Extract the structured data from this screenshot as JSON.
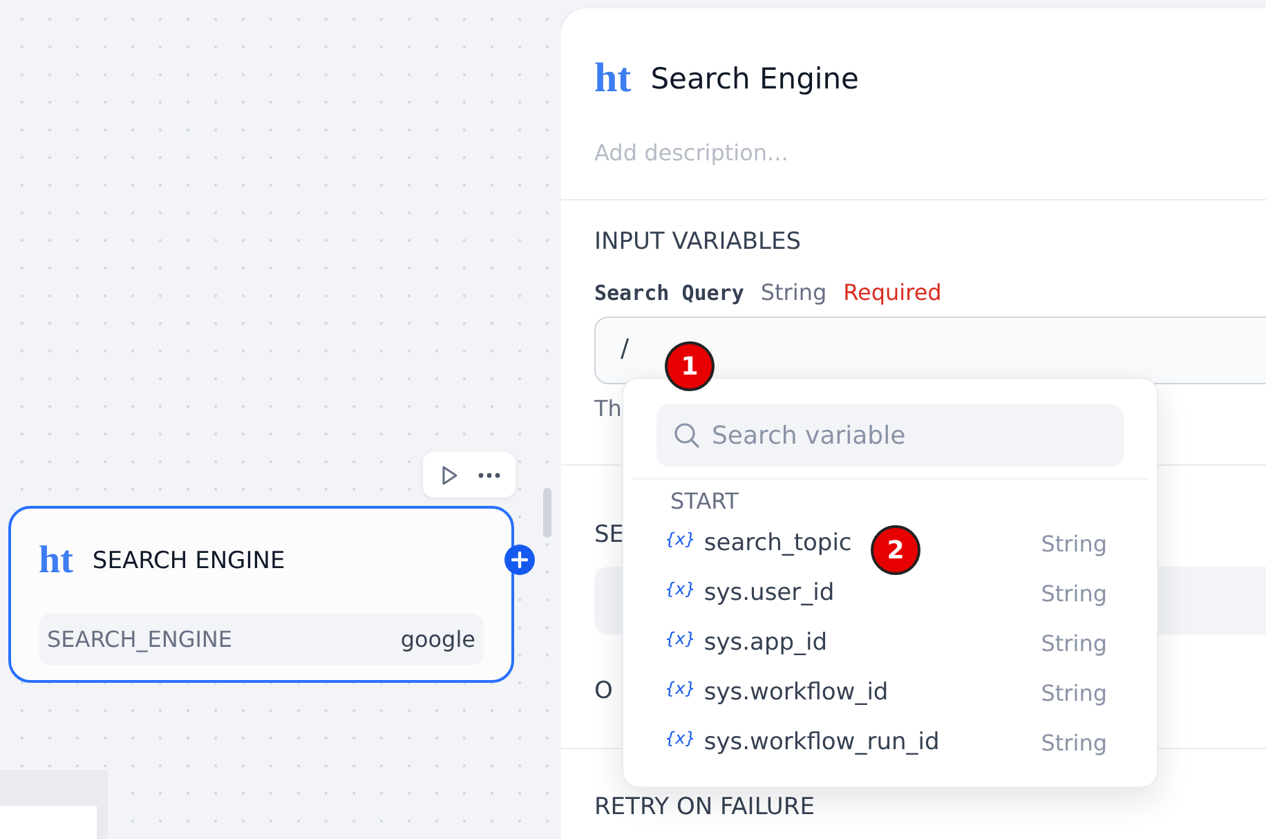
{
  "canvas": {
    "node": {
      "logo": "ht",
      "title": "SEARCH ENGINE",
      "selected": true,
      "params": [
        {
          "name": "SEARCH_ENGINE",
          "value": "google"
        }
      ]
    }
  },
  "panel": {
    "logo": "ht",
    "title": "Search Engine",
    "description_placeholder": "Add description...",
    "sections": [
      {
        "kind": "inputs",
        "title": "INPUT VARIABLES",
        "field": {
          "label": "Search Query",
          "type": "String",
          "required": "Required",
          "value": "/",
          "help": "Th"
        }
      },
      {
        "kind": "select",
        "title": "SE"
      },
      {
        "kind": "heading",
        "title": "O"
      },
      {
        "kind": "heading",
        "title": "RETRY ON FAILURE"
      }
    ]
  },
  "dropdown": {
    "search_placeholder": "Search variable",
    "group": "START",
    "items": [
      {
        "icon": "{x}",
        "name": "search_topic",
        "type": "String"
      },
      {
        "icon": "{x}",
        "name": "sys.user_id",
        "type": "String"
      },
      {
        "icon": "{x}",
        "name": "sys.app_id",
        "type": "String"
      },
      {
        "icon": "{x}",
        "name": "sys.workflow_id",
        "type": "String"
      },
      {
        "icon": "{x}",
        "name": "sys.workflow_run_id",
        "type": "String"
      }
    ]
  },
  "markers": [
    {
      "label": "1"
    },
    {
      "label": "2"
    }
  ]
}
